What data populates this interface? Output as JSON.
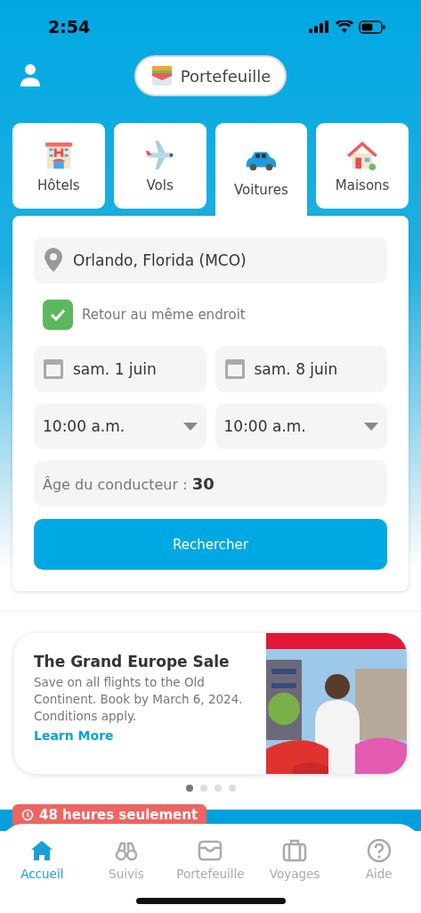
{
  "status_bar": {
    "time": "2:54"
  },
  "header": {
    "wallet_button": "Portefeuille"
  },
  "categories": [
    {
      "label": "Hôtels",
      "kind": "hotel",
      "selected": false
    },
    {
      "label": "Vols",
      "kind": "plane",
      "selected": false
    },
    {
      "label": "Voitures",
      "kind": "car",
      "selected": true
    },
    {
      "label": "Maisons",
      "kind": "house",
      "selected": false
    }
  ],
  "form": {
    "location": "Orlando, Florida (MCO)",
    "same_place": {
      "label": "Retour au même endroit",
      "checked": true
    },
    "dates": [
      "sam. 1 juin",
      "sam. 8 juin"
    ],
    "times": [
      "10:00 a.m.",
      "10:00 a.m."
    ],
    "driver_age": "Âge du conducteur : **30**",
    "search_button": "Rechercher"
  },
  "promo": {
    "title": "The Grand Europe Sale",
    "body": "Save on all flights to the Old Continent. Book by March 6, 2024. Conditions apply.",
    "link": "Learn More"
  },
  "pagination": [
    {
      "selected": true
    },
    {
      "selected": false
    },
    {
      "selected": false
    },
    {
      "selected": false
    }
  ],
  "banner": {
    "tag": "48 heures seulement"
  },
  "bottom_nav": [
    {
      "label": "Accueil",
      "kind": "home",
      "selected": true
    },
    {
      "label": "Suivis",
      "kind": "binoculars",
      "selected": false
    },
    {
      "label": "Portefeuille",
      "kind": "wallet",
      "selected": false
    },
    {
      "label": "Voyages",
      "kind": "suitcase",
      "selected": false
    },
    {
      "label": "Aide",
      "kind": "help",
      "selected": false
    }
  ]
}
